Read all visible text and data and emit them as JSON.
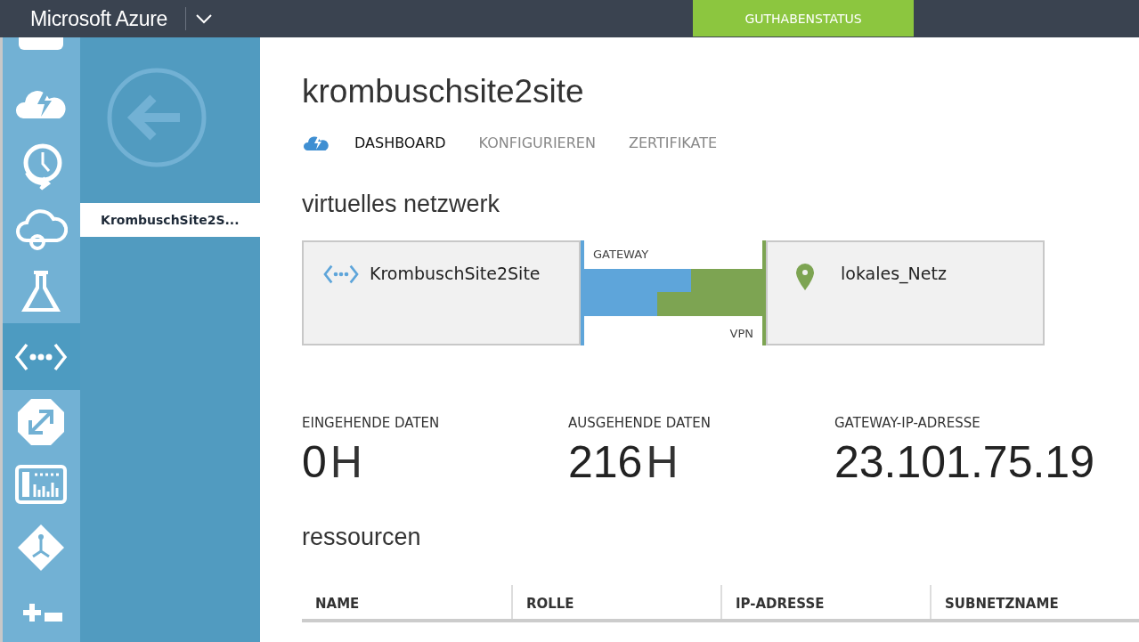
{
  "header": {
    "brand": "Microsoft Azure",
    "credit_button": "GUTHABENSTATUS"
  },
  "nav_icons": [
    {
      "kind": "partial",
      "selected": false
    },
    {
      "kind": "cloud-bolt",
      "selected": false
    },
    {
      "kind": "clock",
      "selected": false
    },
    {
      "kind": "cloud",
      "selected": false
    },
    {
      "kind": "flask",
      "selected": false
    },
    {
      "kind": "network",
      "selected": true
    },
    {
      "kind": "octagon",
      "selected": false
    },
    {
      "kind": "dashboard",
      "selected": false
    },
    {
      "kind": "diamond",
      "selected": false
    },
    {
      "kind": "plus",
      "selected": false
    }
  ],
  "sub_nav": {
    "items": [
      {
        "label": "KrombuschSite2S...",
        "selected": true
      }
    ]
  },
  "page": {
    "title": "krombuschsite2site",
    "tabs": [
      {
        "label": "DASHBOARD",
        "selected": true
      },
      {
        "label": "KONFIGURIEREN",
        "selected": false
      },
      {
        "label": "ZERTIFIKATE",
        "selected": false
      }
    ],
    "network_heading": "virtuelles netzwerk",
    "network": {
      "virtual": "KrombuschSite2Site",
      "gateway_label": "GATEWAY",
      "vpn_label": "VPN",
      "local": "lokales_Netz"
    },
    "metrics": [
      {
        "label": "EINGEHENDE DATEN",
        "value": "0",
        "unit": "H"
      },
      {
        "label": "AUSGEHENDE DATEN",
        "value": "216",
        "unit": "H"
      },
      {
        "label": "GATEWAY-IP-ADRESSE",
        "value": "23.101.75.19"
      }
    ],
    "resources_heading": "ressourcen",
    "table": {
      "columns": [
        "NAME",
        "ROLLE",
        "IP-ADRESSE",
        "SUBNETZNAME"
      ]
    }
  }
}
